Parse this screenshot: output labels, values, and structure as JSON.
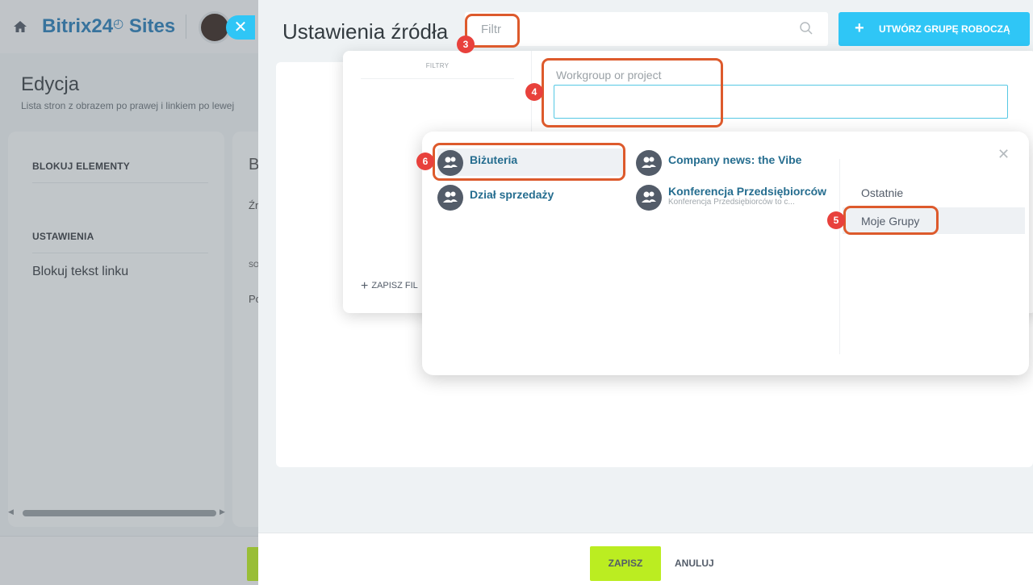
{
  "background": {
    "brand": "Bitrix24",
    "brand_suffix": "Sites",
    "page_title": "Edycja",
    "page_subtitle": "Lista stron z obrazem po prawej i linkiem po lewej",
    "sidebar": {
      "section_blocks": "BLOKUJ ELEMENTY",
      "section_settings": "USTAWIENIA",
      "item_link_text": "Blokuj tekst linku"
    },
    "content_fragments": [
      "B",
      "Źr",
      "SO",
      "Po"
    ]
  },
  "slider": {
    "title": "Ustawienia źródła",
    "filter_placeholder": "Filtr",
    "create_button": "UTWÓRZ GRUPĘ ROBOCZĄ",
    "save_button": "ZAPISZ",
    "cancel_button": "ANULUJ"
  },
  "filter_popup": {
    "header": "FILTRY",
    "save_filter": "ZAPISZ FIL",
    "field_label": "Workgroup or project",
    "field_value": ""
  },
  "dropdown": {
    "groups": [
      {
        "name": "Biżuteria",
        "description": "",
        "selected": true
      },
      {
        "name": "Company news: the Vibe",
        "description": "",
        "selected": false
      },
      {
        "name": "Dział sprzedaży",
        "description": "",
        "selected": false
      },
      {
        "name": "Konferencja Przedsiębiorców",
        "description": "Konferencja Przedsiębiorców to c...",
        "selected": false
      }
    ],
    "tabs": [
      {
        "label": "Ostatnie",
        "active": false
      },
      {
        "label": "Moje Grupy",
        "active": true
      }
    ]
  },
  "annotations": {
    "step_filter": "3",
    "step_field": "4",
    "step_tab": "5",
    "step_group": "6",
    "color": "#dd5a2c",
    "badge_color": "#e8413c"
  },
  "colors": {
    "accent_blue": "#2fc6f6",
    "save_green": "#bbed21",
    "group_link": "#256d8f"
  }
}
